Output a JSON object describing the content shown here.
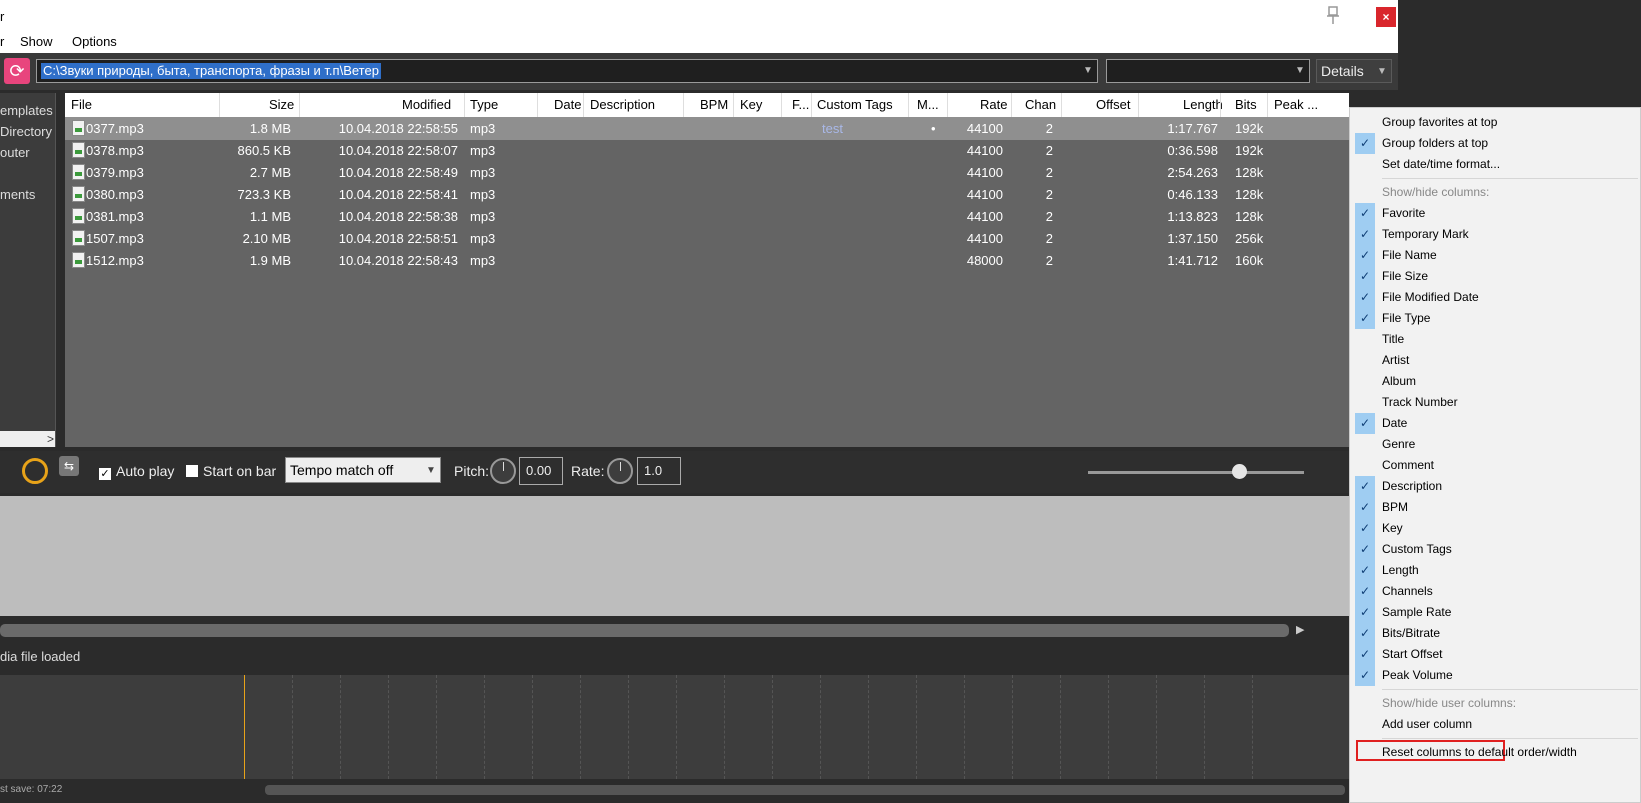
{
  "window": {
    "title": "r",
    "close_label": "×"
  },
  "menu": [
    "r",
    "Show",
    "Options"
  ],
  "pathbar": {
    "path": "C:\\Звуки природы, быта, транспорта, фразы и т.п\\Ветер",
    "view_mode": "Details"
  },
  "tree": {
    "items": [
      "emplates",
      "Directory",
      "outer",
      "ments"
    ]
  },
  "list": {
    "columns": [
      "File",
      "Size",
      "Modified",
      "Type",
      "Date",
      "Description",
      "BPM",
      "Key",
      "F...",
      "Custom Tags",
      "M...",
      "Rate",
      "Chan",
      "Offset",
      "Length",
      "Bits",
      "Peak ..."
    ],
    "rows": [
      {
        "file": "0377.mp3",
        "size": "1.8 MB",
        "modified": "10.04.2018 22:58:55",
        "type": "mp3",
        "tags": "test",
        "mark": "•",
        "rate": "44100",
        "chan": "2",
        "length": "1:17.767",
        "bits": "192k",
        "selected": true
      },
      {
        "file": "0378.mp3",
        "size": "860.5 KB",
        "modified": "10.04.2018 22:58:07",
        "type": "mp3",
        "tags": "",
        "mark": "",
        "rate": "44100",
        "chan": "2",
        "length": "0:36.598",
        "bits": "192k",
        "selected": false
      },
      {
        "file": "0379.mp3",
        "size": "2.7 MB",
        "modified": "10.04.2018 22:58:49",
        "type": "mp3",
        "tags": "",
        "mark": "",
        "rate": "44100",
        "chan": "2",
        "length": "2:54.263",
        "bits": "128k",
        "selected": false
      },
      {
        "file": "0380.mp3",
        "size": "723.3 KB",
        "modified": "10.04.2018 22:58:41",
        "type": "mp3",
        "tags": "",
        "mark": "",
        "rate": "44100",
        "chan": "2",
        "length": "0:46.133",
        "bits": "128k",
        "selected": false
      },
      {
        "file": "0381.mp3",
        "size": "1.1 MB",
        "modified": "10.04.2018 22:58:38",
        "type": "mp3",
        "tags": "",
        "mark": "",
        "rate": "44100",
        "chan": "2",
        "length": "1:13.823",
        "bits": "128k",
        "selected": false
      },
      {
        "file": "1507.mp3",
        "size": "2.10 MB",
        "modified": "10.04.2018 22:58:51",
        "type": "mp3",
        "tags": "",
        "mark": "",
        "rate": "44100",
        "chan": "2",
        "length": "1:37.150",
        "bits": "256k",
        "selected": false
      },
      {
        "file": "1512.mp3",
        "size": "1.9 MB",
        "modified": "10.04.2018 22:58:43",
        "type": "mp3",
        "tags": "",
        "mark": "",
        "rate": "48000",
        "chan": "2",
        "length": "1:41.712",
        "bits": "160k",
        "selected": false
      }
    ]
  },
  "transport": {
    "auto_play": "Auto play",
    "start_on_bar": "Start on bar",
    "tempo": "Tempo match off",
    "pitch_label": "Pitch:",
    "pitch_value": "0.00",
    "rate_label": "Rate:",
    "rate_value": "1.0"
  },
  "status": {
    "text": "dia file loaded",
    "last_save": "st save: 07:22"
  },
  "context_menu": {
    "items": [
      {
        "label": "Group favorites at top",
        "checked": false,
        "type": "item"
      },
      {
        "label": "Group folders at top",
        "checked": true,
        "type": "item"
      },
      {
        "label": "Set date/time format...",
        "checked": false,
        "type": "item"
      },
      {
        "type": "sep"
      },
      {
        "label": "Show/hide columns:",
        "checked": false,
        "type": "header"
      },
      {
        "label": "Favorite",
        "checked": true,
        "type": "item"
      },
      {
        "label": "Temporary Mark",
        "checked": true,
        "type": "item"
      },
      {
        "label": "File Name",
        "checked": true,
        "type": "item"
      },
      {
        "label": "File Size",
        "checked": true,
        "type": "item"
      },
      {
        "label": "File Modified Date",
        "checked": true,
        "type": "item"
      },
      {
        "label": "File Type",
        "checked": true,
        "type": "item"
      },
      {
        "label": "Title",
        "checked": false,
        "type": "item"
      },
      {
        "label": "Artist",
        "checked": false,
        "type": "item"
      },
      {
        "label": "Album",
        "checked": false,
        "type": "item"
      },
      {
        "label": "Track Number",
        "checked": false,
        "type": "item"
      },
      {
        "label": "Date",
        "checked": true,
        "type": "item"
      },
      {
        "label": "Genre",
        "checked": false,
        "type": "item"
      },
      {
        "label": "Comment",
        "checked": false,
        "type": "item"
      },
      {
        "label": "Description",
        "checked": true,
        "type": "item"
      },
      {
        "label": "BPM",
        "checked": true,
        "type": "item"
      },
      {
        "label": "Key",
        "checked": true,
        "type": "item"
      },
      {
        "label": "Custom Tags",
        "checked": true,
        "type": "item"
      },
      {
        "label": "Length",
        "checked": true,
        "type": "item"
      },
      {
        "label": "Channels",
        "checked": true,
        "type": "item"
      },
      {
        "label": "Sample Rate",
        "checked": true,
        "type": "item"
      },
      {
        "label": "Bits/Bitrate",
        "checked": true,
        "type": "item"
      },
      {
        "label": "Start Offset",
        "checked": true,
        "type": "item"
      },
      {
        "label": "Peak Volume",
        "checked": true,
        "type": "item"
      },
      {
        "type": "sep"
      },
      {
        "label": "Show/hide user columns:",
        "checked": false,
        "type": "header"
      },
      {
        "label": "Add user column",
        "checked": false,
        "type": "item"
      },
      {
        "type": "sep"
      },
      {
        "label": "Reset columns to default order/width",
        "checked": false,
        "type": "item"
      }
    ]
  },
  "colors": {
    "accent": "#2f6fc9",
    "refresh": "#e8457d",
    "highlight": "#e02020",
    "check": "#9fcdf2"
  }
}
